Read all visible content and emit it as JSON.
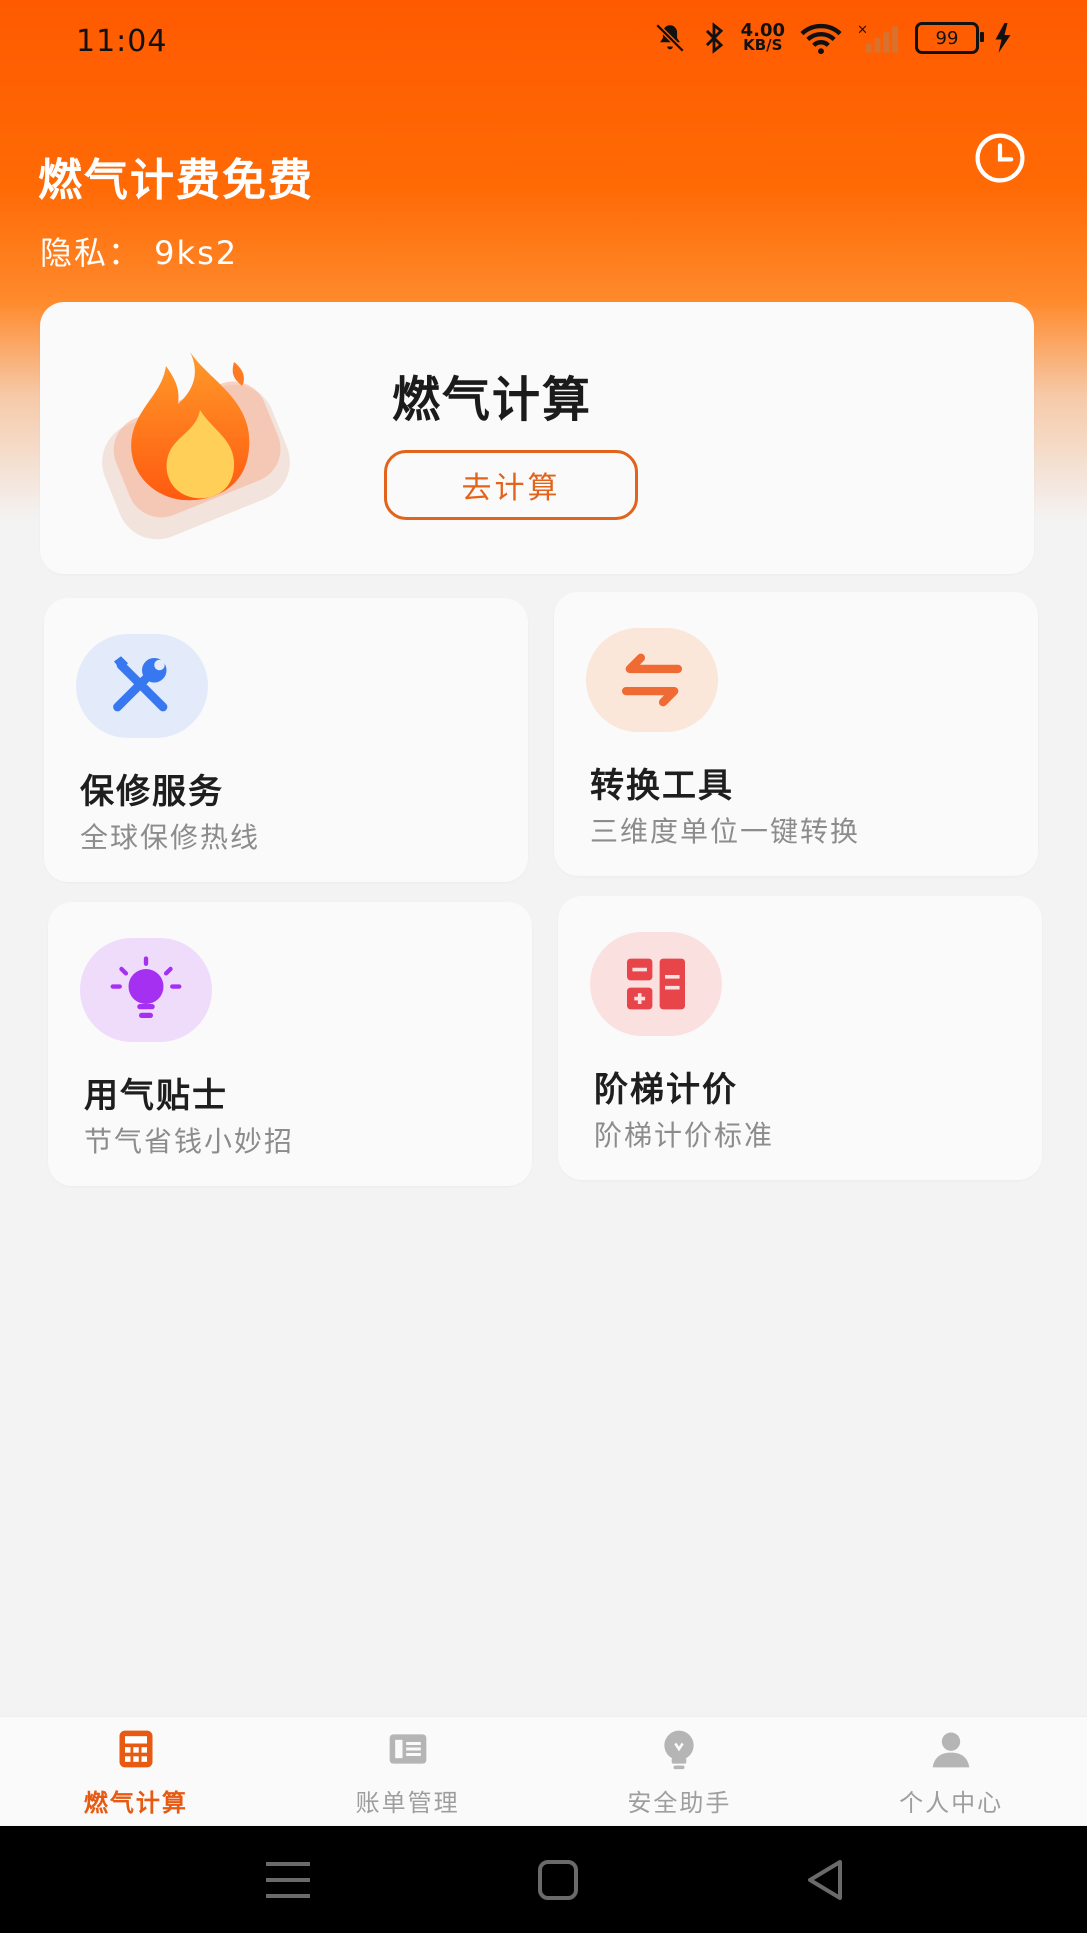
{
  "status_bar": {
    "time": "11:04",
    "speed_value": "4.00",
    "speed_unit": "KB/S",
    "battery": "99"
  },
  "header": {
    "title": "燃气计费免费",
    "privacy": "隐私：  9ks2",
    "history_icon": "clock-icon"
  },
  "hero": {
    "title": "燃气计算",
    "button": "去计算",
    "illustration": "flame-icon"
  },
  "tiles": [
    {
      "title": "保修服务",
      "subtitle": "全球保修热线",
      "icon": "tools-icon",
      "bubble_color": "#e3ebfb"
    },
    {
      "title": "转换工具",
      "subtitle": "三维度单位一键转换",
      "icon": "swap-icon",
      "bubble_color": "#fbe6da"
    },
    {
      "title": "用气贴士",
      "subtitle": "节气省钱小妙招",
      "icon": "bulb-icon",
      "bubble_color": "#efdcfb"
    },
    {
      "title": "阶梯计价",
      "subtitle": "阶梯计价标准",
      "icon": "calculator-icon",
      "bubble_color": "#fbe0e0"
    }
  ],
  "tabs": [
    {
      "label": "燃气计算",
      "icon": "calculator-tab-icon",
      "active": true
    },
    {
      "label": "账单管理",
      "icon": "bill-icon",
      "active": false
    },
    {
      "label": "安全助手",
      "icon": "bulb-tab-icon",
      "active": false
    },
    {
      "label": "个人中心",
      "icon": "user-icon",
      "active": false
    }
  ],
  "colors": {
    "brand_orange": "#ff5a00",
    "accent": "#e85a12",
    "tools_blue": "#3777f0",
    "swap_orange": "#f06a33",
    "bulb_purple": "#a530f2",
    "calc_red": "#e8454b"
  }
}
